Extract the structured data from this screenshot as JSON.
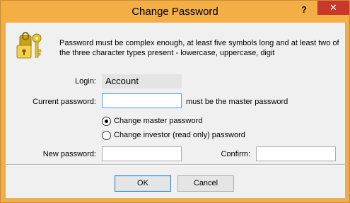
{
  "window": {
    "title": "Change Password",
    "help_label": "?",
    "close_label": "✕"
  },
  "info_text": "Password must be complex enough, at least five symbols long and at least two of the three character types present - lowercase, uppercase, digit",
  "form": {
    "login_label": "Login:",
    "login_value": "Account",
    "current_password_label": "Current password:",
    "current_password_value": "",
    "current_password_note": "must be the master password",
    "radio_master_label": "Change master password",
    "radio_investor_label": "Change investor (read only) password",
    "selected_option": "master",
    "new_password_label": "New password:",
    "new_password_value": "",
    "confirm_label": "Confirm:",
    "confirm_value": ""
  },
  "buttons": {
    "ok": "OK",
    "cancel": "Cancel"
  }
}
